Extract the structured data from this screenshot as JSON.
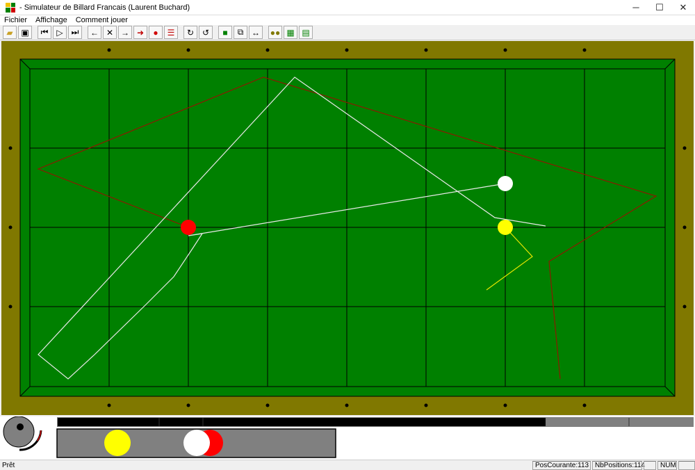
{
  "window": {
    "title": "- Simulateur de Billard Francais (Laurent Buchard)",
    "minimize": "─",
    "maximize": "☐",
    "close": "✕"
  },
  "menu": [
    "Fichier",
    "Affichage",
    "Comment jouer"
  ],
  "toolbar": {
    "groups": [
      [
        "open-icon",
        "save-icon"
      ],
      [
        "first-position-icon",
        "play-icon",
        "last-position-icon"
      ],
      [
        "arrow-left-icon",
        "delete-icon",
        "arrow-right-icon",
        "red-arrow-right-icon",
        "red-ball-stack-icon",
        "numbered-list-icon"
      ],
      [
        "rotate-left-icon",
        "rotate-right-icon"
      ],
      [
        "balls-view-icon",
        "tilted-view-icon",
        "horizontal-resize-icon"
      ],
      [
        "ball-pair-icon",
        "table-grid-icon",
        "table-layout-icon"
      ]
    ]
  },
  "colors": {
    "rail": "#807800",
    "cloth": "#008000",
    "red_ball": "#ff0000",
    "white_ball": "#ffffff",
    "yellow_ball": "#ffff00",
    "white_path": "#e8e8e8",
    "red_path": "#8b1a00",
    "yellow_path": "#e6e600"
  },
  "balls": {
    "white": "white",
    "yellow": "yellow",
    "red": "red"
  },
  "progress": {
    "played_fraction": 0.768
  },
  "cue_panel": {
    "selected_balls": [
      "yellow",
      "white",
      "red"
    ]
  },
  "status": {
    "ready": "Prêt",
    "pos_courante": "PosCourante:113",
    "nb_positions": "NbPositions:114",
    "num": "NUM"
  }
}
